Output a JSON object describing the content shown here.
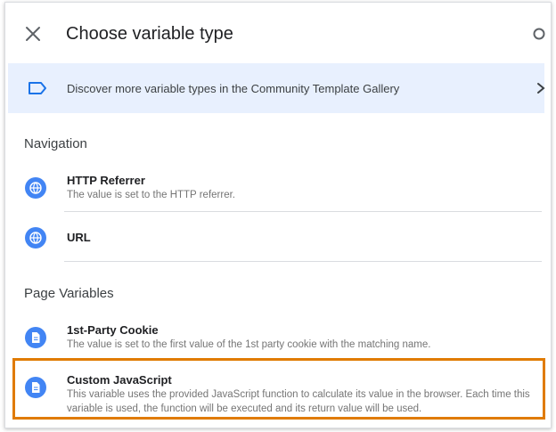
{
  "header": {
    "title": "Choose variable type"
  },
  "gallery": {
    "text": "Discover more variable types in the Community Template Gallery"
  },
  "sections": [
    {
      "title": "Navigation",
      "items": [
        {
          "name": "HTTP Referrer",
          "description": "The value is set to the HTTP referrer.",
          "icon": "globe-icon"
        },
        {
          "name": "URL",
          "description": "",
          "icon": "globe-icon"
        }
      ]
    },
    {
      "title": "Page Variables",
      "items": [
        {
          "name": "1st-Party Cookie",
          "description": "The value is set to the first value of the 1st party cookie with the matching name.",
          "icon": "document-icon"
        },
        {
          "name": "Custom JavaScript",
          "description": "This variable uses the provided JavaScript function to calculate its value in the browser. Each time this variable is used, the function will be executed and its return value will be used.",
          "icon": "document-icon"
        }
      ]
    }
  ],
  "colors": {
    "accent_blue": "#4285f4",
    "gallery_bg": "#e8f0fe",
    "highlight_orange": "#e07b00"
  }
}
